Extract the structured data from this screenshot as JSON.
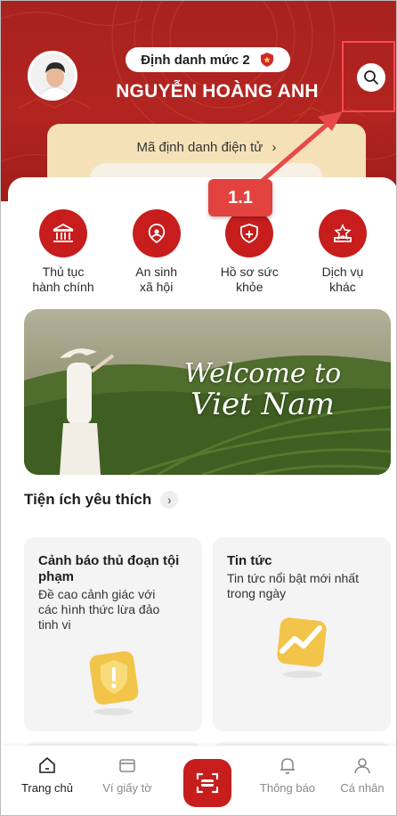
{
  "header": {
    "level_label": "Định danh mức 2",
    "user_name": "NGUYỄN HOÀNG ANH",
    "id_card_label": "Mã định danh điện tử",
    "id_card_chevron": "›",
    "search_icon": "search-icon"
  },
  "shortcuts": [
    {
      "line1": "Thủ tục",
      "line2": "hành chính",
      "icon": "government-building-icon"
    },
    {
      "line1": "An sinh",
      "line2": "xã hội",
      "icon": "social-welfare-icon"
    },
    {
      "line1": "Hồ sơ sức",
      "line2": "khỏe",
      "icon": "health-record-icon"
    },
    {
      "line1": "Dịch vụ",
      "line2": "khác",
      "icon": "other-services-icon"
    }
  ],
  "banner": {
    "line1": "Welcome to",
    "line2": "Viet Nam"
  },
  "favorites": {
    "title": "Tiện ích yêu thích",
    "chevron": "›"
  },
  "cards": [
    {
      "title_line1": "Cảnh báo thủ đoạn tội",
      "title_line2": "phạm",
      "desc_line1": "Đề cao cảnh giác với",
      "desc_line2": "các hình thức lừa đảo",
      "desc_line3": "tinh vi",
      "icon": "warning-shield-icon"
    },
    {
      "title": "Tin tức",
      "desc_line1": "Tin tức nổi bật mới nhất",
      "desc_line2": "trong ngày",
      "icon": "trend-chart-icon"
    }
  ],
  "annotation": {
    "label": "1.1"
  },
  "bottom_nav": {
    "items": [
      {
        "label": "Trang chủ",
        "icon": "home-icon"
      },
      {
        "label": "Ví giấy tờ",
        "icon": "wallet-icon"
      },
      {
        "label": "",
        "icon": "scan-icon"
      },
      {
        "label": "Thông báo",
        "icon": "bell-icon"
      },
      {
        "label": "Cá nhân",
        "icon": "person-icon"
      }
    ]
  },
  "colors": {
    "primary_red": "#c71d1d",
    "header_red": "#a8221f",
    "annotation_red": "#e2433f",
    "card_gold": "#f5e1b8"
  }
}
